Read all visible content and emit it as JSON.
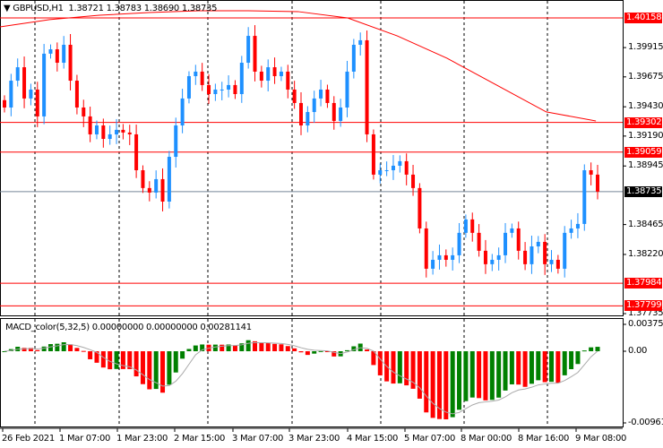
{
  "header": {
    "symbol": "GBPUSD,H1",
    "open": "1.38721",
    "high": "1.38783",
    "low": "1.38690",
    "close": "1.38735"
  },
  "price_axis": {
    "labels": [
      "1.39915",
      "1.39675",
      "1.39430",
      "1.39190",
      "1.38945",
      "1.38465",
      "1.38220",
      "1.37735"
    ],
    "top": 1.40305,
    "per_unit": 13620
  },
  "levels": [
    {
      "price": "1.40158",
      "color": "#ff0000"
    },
    {
      "price": "1.39302",
      "color": "#ff0000"
    },
    {
      "price": "1.39059",
      "color": "#ff0000"
    },
    {
      "price": "1.37984",
      "color": "#ff0000"
    },
    {
      "price": "1.37799",
      "color": "#ff0000"
    }
  ],
  "current_price": {
    "price": "1.38735",
    "color": "#778899"
  },
  "time_axis": [
    "26 Feb 2021",
    "1 Mar 07:00",
    "1 Mar 23:00",
    "2 Mar 15:00",
    "3 Mar 07:00",
    "3 Mar 23:00",
    "4 Mar 15:00",
    "5 Mar 07:00",
    "8 Mar 00:00",
    "8 Mar 16:00",
    "9 Mar 08:00"
  ],
  "closes": [
    1.39424,
    1.39644,
    1.39754,
    1.39498,
    1.39571,
    1.39351,
    1.39865,
    1.39901,
    1.39791,
    1.39938,
    1.39644,
    1.39424,
    1.39351,
    1.39204,
    1.39277,
    1.39167,
    1.39204,
    1.39241,
    1.39219,
    1.39204,
    1.3891,
    1.38764,
    1.38727,
    1.38837,
    1.38653,
    1.3902,
    1.39277,
    1.39498,
    1.39681,
    1.39718,
    1.39608,
    1.39534,
    1.39571,
    1.39571,
    1.39608,
    1.39534,
    1.39791,
    1.40011,
    1.39718,
    1.39644,
    1.39754,
    1.39681,
    1.39718,
    1.39571,
    1.39461,
    1.39277,
    1.39387,
    1.39498,
    1.39571,
    1.39461,
    1.39314,
    1.39424,
    1.39718,
    1.39938,
    1.39975,
    1.39204,
    1.38874,
    1.3891,
    1.3891,
    1.38947,
    1.38984,
    1.38874,
    1.38764,
    1.38433,
    1.38103,
    1.38176,
    1.38213,
    1.38176,
    1.38213,
    1.38397,
    1.38507,
    1.38397,
    1.3825,
    1.3814,
    1.38176,
    1.38213,
    1.38397,
    1.38433,
    1.3825,
    1.3814,
    1.38286,
    1.38323,
    1.3814,
    1.38176,
    1.38103,
    1.38397,
    1.38433,
    1.3847,
    1.3891,
    1.38874,
    1.38735
  ],
  "moving_average": [
    1.40085,
    1.40144,
    1.4018,
    1.40202,
    1.40217,
    1.40217,
    1.4021,
    1.40158,
    1.40011,
    1.39828,
    1.39608,
    1.39388,
    1.39314
  ],
  "macd": {
    "title": "MACD_color(5,32,5) 0.00000000 0.00000000 0.00281141",
    "max_label": "0.0037521",
    "zero_label": "0.00",
    "min_label": "-0.009619",
    "max": 0.0037521,
    "min": -0.009619
  },
  "colors": {
    "bull": "#1e90ff",
    "bear": "#ff0000",
    "macd_up": "#008000",
    "macd_down": "#ff0000"
  }
}
